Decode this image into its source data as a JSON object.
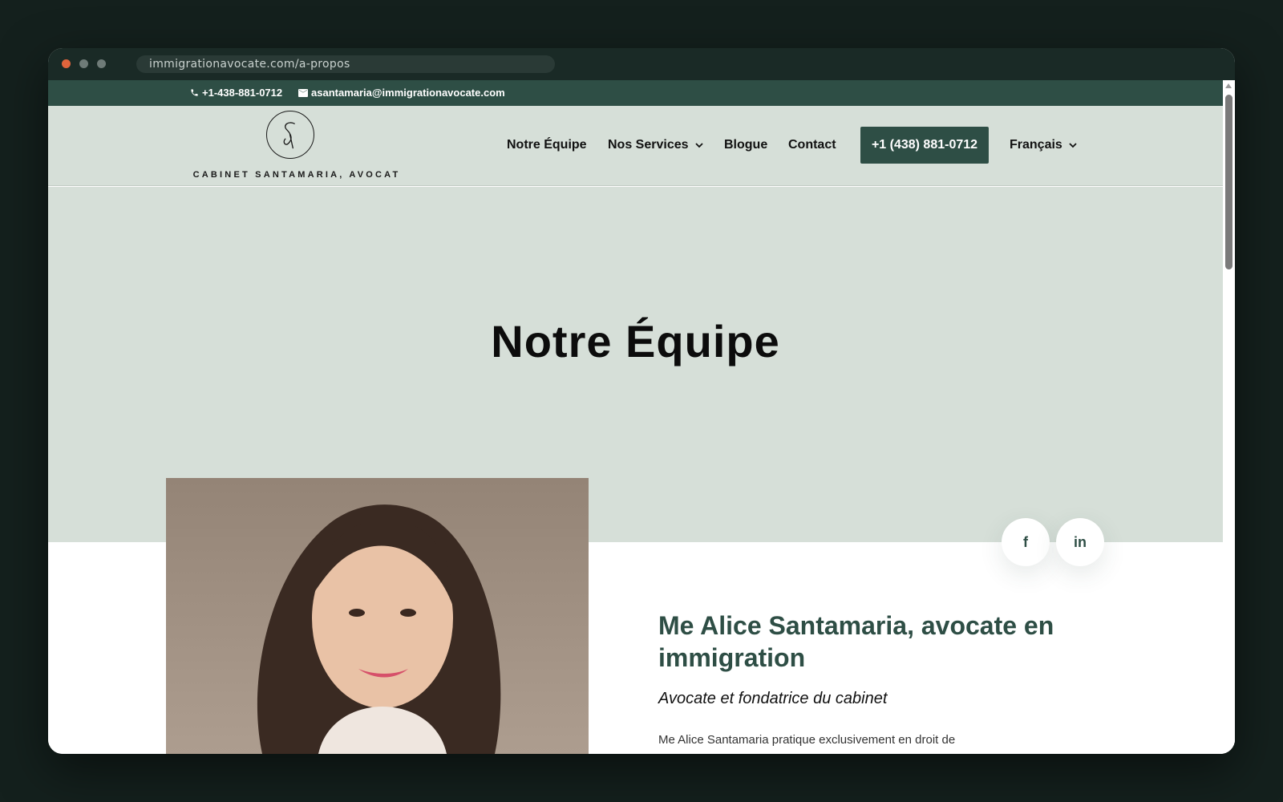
{
  "browser": {
    "url": "immigrationavocate.com/a-propos"
  },
  "topbar": {
    "phone": "+1-438-881-0712",
    "email": "asantamaria@immigrationavocate.com"
  },
  "header": {
    "logo_text": "CABINET SANTAMARIA, AVOCAT",
    "nav": {
      "team": "Notre Équipe",
      "services": "Nos Services",
      "blog": "Blogue",
      "contact": "Contact",
      "language": "Français"
    },
    "cta_label": "+1 (438) 881-0712"
  },
  "hero": {
    "title": "Notre Équipe"
  },
  "social": {
    "facebook": "f",
    "linkedin": "in"
  },
  "bio": {
    "title": "Me Alice Santamaria, avocate en immigration",
    "subtitle": "Avocate et fondatrice du cabinet",
    "text": "Me Alice Santamaria pratique exclusivement en droit de"
  },
  "colors": {
    "brand_dark_green": "#2e4e45",
    "sage_background": "#d6dfd8",
    "window_background": "#14201d"
  }
}
